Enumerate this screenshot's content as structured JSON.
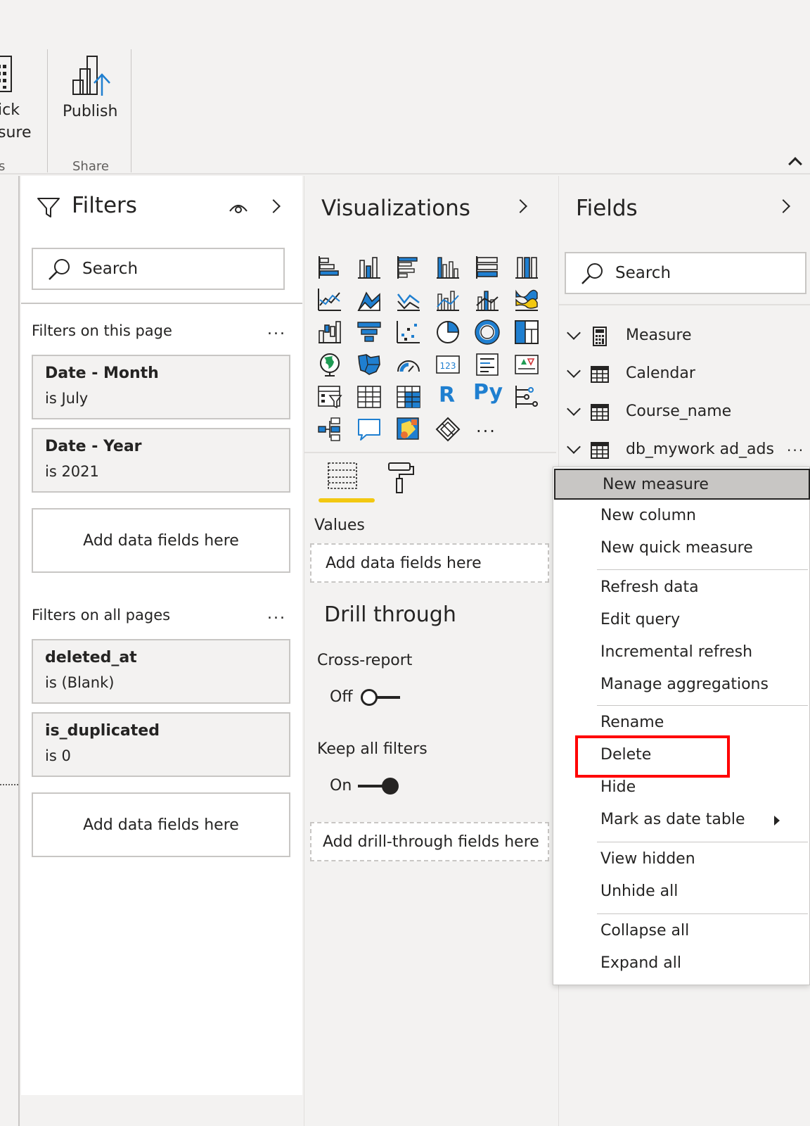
{
  "ribbon": {
    "quick_measure_label_line1": "ick",
    "quick_measure_label_line2": "sure",
    "calc_group_label": "s",
    "publish_label": "Publish",
    "share_group_label": "Share"
  },
  "filters": {
    "title": "Filters",
    "search_placeholder": "Search",
    "this_page_label": "Filters on this page",
    "all_pages_label": "Filters on all pages",
    "more": "...",
    "page_cards": [
      {
        "title": "Date - Month",
        "condition": "is July"
      },
      {
        "title": "Date - Year",
        "condition": "is 2021"
      }
    ],
    "all_cards": [
      {
        "title": "deleted_at",
        "condition": "is (Blank)"
      },
      {
        "title": "is_duplicated",
        "condition": "is 0"
      }
    ],
    "add_fields_label": "Add data fields here"
  },
  "visualizations": {
    "title": "Visualizations",
    "r_icon": "R",
    "py_icon": "Py",
    "more": "...",
    "values_label": "Values",
    "values_placeholder": "Add data fields here",
    "drill_title": "Drill through",
    "cross_report_label": "Cross-report",
    "cross_report_state": "Off",
    "keep_filters_label": "Keep all filters",
    "keep_filters_state": "On",
    "drill_placeholder": "Add drill-through fields here",
    "accent_color": "#f2c811",
    "icon_blue": "#1f7fd0"
  },
  "fields": {
    "title": "Fields",
    "search_placeholder": "Search",
    "tables": [
      {
        "name": "Measure",
        "icon": "calculator-icon"
      },
      {
        "name": "Calendar",
        "icon": "table-icon"
      },
      {
        "name": "Course_name",
        "icon": "table-icon"
      },
      {
        "name": "db_mywork ad_ads",
        "icon": "table-icon"
      }
    ],
    "more": "..."
  },
  "context_menu": {
    "items": [
      "New measure",
      "New column",
      "New quick measure",
      "Refresh data",
      "Edit query",
      "Incremental refresh",
      "Manage aggregations",
      "Rename",
      "Delete",
      "Hide",
      "Mark as date table",
      "View hidden",
      "Unhide all",
      "Collapse all",
      "Expand all"
    ],
    "highlight_color": "#ff0000"
  }
}
